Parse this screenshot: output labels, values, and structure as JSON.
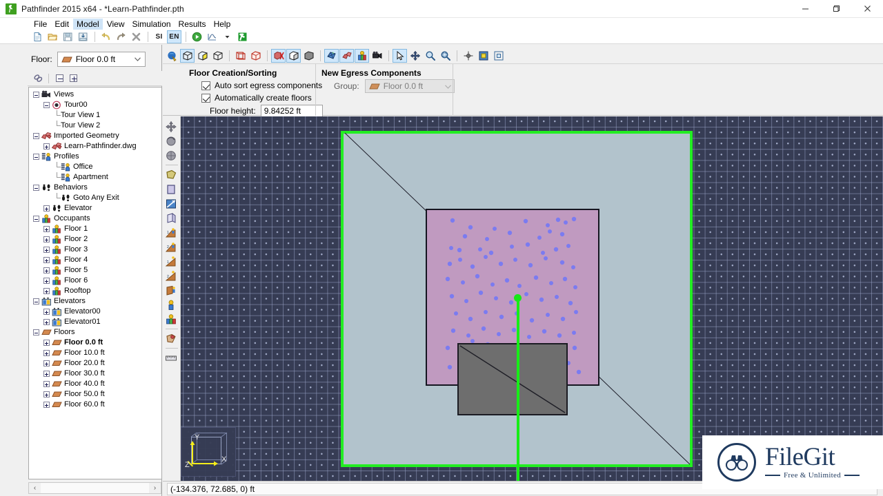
{
  "window": {
    "title": "Pathfinder 2015 x64 - *Learn-Pathfinder.pth",
    "app_icon": "pathfinder-runner-icon",
    "minimize": "—",
    "maximize": "❐",
    "close": "✕"
  },
  "menu": {
    "items": [
      {
        "label": "File",
        "active": false
      },
      {
        "label": "Edit",
        "active": false
      },
      {
        "label": "Model",
        "active": true
      },
      {
        "label": "View",
        "active": false
      },
      {
        "label": "Simulation",
        "active": false
      },
      {
        "label": "Results",
        "active": false
      },
      {
        "label": "Help",
        "active": false
      }
    ]
  },
  "toolbar": {
    "items": [
      {
        "name": "new-file-icon",
        "label": ""
      },
      {
        "name": "open-folder-icon",
        "label": ""
      },
      {
        "name": "save-icon",
        "label": ""
      },
      {
        "name": "save-as-icon",
        "label": ""
      },
      {
        "name": "undo-icon",
        "label": ""
      },
      {
        "name": "redo-icon",
        "label": ""
      },
      {
        "name": "delete-icon",
        "label": ""
      },
      {
        "name": "units-si-button",
        "label": "SI"
      },
      {
        "name": "units-en-button",
        "label": "EN"
      },
      {
        "name": "run-simulation-icon",
        "label": ""
      },
      {
        "name": "results-chart-icon",
        "label": ""
      },
      {
        "name": "results-dropdown-icon",
        "label": ""
      },
      {
        "name": "open-results-viewer-icon",
        "label": ""
      }
    ],
    "active_units": "EN"
  },
  "sidebar": {
    "floor_selector": {
      "label": "Floor:",
      "value": "Floor 0.0 ft",
      "icon": "floor-slab-icon"
    },
    "tree_toolbar": {
      "link_icon": "link-chain-icon",
      "collapse_all": "collapse-all-button",
      "expand_all": "expand-all-button"
    },
    "scrollbar": {
      "left_arrow": "‹",
      "right_arrow": "›"
    },
    "tree": [
      {
        "label": "Views",
        "indent": 0,
        "toggle": "minus",
        "icon": "camera-icon",
        "bold": false
      },
      {
        "label": "Tour00",
        "indent": 1,
        "toggle": "minus",
        "icon": "tour-icon",
        "bold": false
      },
      {
        "label": "Tour View 1",
        "indent": 2,
        "toggle": "none",
        "icon": "none",
        "bold": false
      },
      {
        "label": "Tour View 2",
        "indent": 2,
        "toggle": "none",
        "icon": "none",
        "bold": false
      },
      {
        "label": "Imported Geometry",
        "indent": 0,
        "toggle": "minus",
        "icon": "geometry-icon",
        "bold": false
      },
      {
        "label": "Learn-Pathfinder.dwg",
        "indent": 1,
        "toggle": "plus",
        "icon": "geometry-icon",
        "bold": false
      },
      {
        "label": "Profiles",
        "indent": 0,
        "toggle": "minus",
        "icon": "profile-icon",
        "bold": false
      },
      {
        "label": "Office",
        "indent": 2,
        "toggle": "none",
        "icon": "profile-icon",
        "bold": false
      },
      {
        "label": "Apartment",
        "indent": 2,
        "toggle": "none",
        "icon": "profile-icon",
        "bold": false
      },
      {
        "label": "Behaviors",
        "indent": 0,
        "toggle": "minus",
        "icon": "footprints-icon",
        "bold": false
      },
      {
        "label": "Goto Any Exit",
        "indent": 2,
        "toggle": "none",
        "icon": "footprints-icon",
        "bold": false
      },
      {
        "label": "Elevator",
        "indent": 1,
        "toggle": "plus",
        "icon": "footprints-icon",
        "bold": false
      },
      {
        "label": "Occupants",
        "indent": 0,
        "toggle": "minus",
        "icon": "occupants-icon",
        "bold": false
      },
      {
        "label": "Floor 1",
        "indent": 1,
        "toggle": "plus",
        "icon": "occupants-icon",
        "bold": false
      },
      {
        "label": "Floor 2",
        "indent": 1,
        "toggle": "plus",
        "icon": "occupants-icon",
        "bold": false
      },
      {
        "label": "Floor 3",
        "indent": 1,
        "toggle": "plus",
        "icon": "occupants-icon",
        "bold": false
      },
      {
        "label": "Floor 4",
        "indent": 1,
        "toggle": "plus",
        "icon": "occupants-icon",
        "bold": false
      },
      {
        "label": "Floor 5",
        "indent": 1,
        "toggle": "plus",
        "icon": "occupants-icon",
        "bold": false
      },
      {
        "label": "Floor 6",
        "indent": 1,
        "toggle": "plus",
        "icon": "occupants-icon",
        "bold": false
      },
      {
        "label": "Rooftop",
        "indent": 1,
        "toggle": "plus",
        "icon": "occupants-icon",
        "bold": false
      },
      {
        "label": "Elevators",
        "indent": 0,
        "toggle": "minus",
        "icon": "elevator-icon",
        "bold": false
      },
      {
        "label": "Elevator00",
        "indent": 1,
        "toggle": "plus",
        "icon": "elevator-icon",
        "bold": false
      },
      {
        "label": "Elevator01",
        "indent": 1,
        "toggle": "plus",
        "icon": "elevator-icon",
        "bold": false
      },
      {
        "label": "Floors",
        "indent": 0,
        "toggle": "minus",
        "icon": "floor-slab-icon",
        "bold": false
      },
      {
        "label": "Floor 0.0 ft",
        "indent": 1,
        "toggle": "plus",
        "icon": "floor-slab-icon",
        "bold": true
      },
      {
        "label": "Floor 10.0 ft",
        "indent": 1,
        "toggle": "plus",
        "icon": "floor-slab-icon",
        "bold": false
      },
      {
        "label": "Floor 20.0 ft",
        "indent": 1,
        "toggle": "plus",
        "icon": "floor-slab-icon",
        "bold": false
      },
      {
        "label": "Floor 30.0 ft",
        "indent": 1,
        "toggle": "plus",
        "icon": "floor-slab-icon",
        "bold": false
      },
      {
        "label": "Floor 40.0 ft",
        "indent": 1,
        "toggle": "plus",
        "icon": "floor-slab-icon",
        "bold": false
      },
      {
        "label": "Floor 50.0 ft",
        "indent": 1,
        "toggle": "plus",
        "icon": "floor-slab-icon",
        "bold": false
      },
      {
        "label": "Floor 60.0 ft",
        "indent": 1,
        "toggle": "plus",
        "icon": "floor-slab-icon",
        "bold": false
      }
    ]
  },
  "options": {
    "floor_creation": {
      "title": "Floor Creation/Sorting",
      "auto_sort_label": "Auto sort egress components",
      "auto_sort_checked": true,
      "auto_create_label": "Automatically create floors",
      "auto_create_checked": true,
      "floor_height_label": "Floor height:",
      "floor_height_value": "9.84252 ft"
    },
    "new_egress": {
      "title": "New Egress Components",
      "group_label": "Group:",
      "group_value": "Floor 0.0 ft",
      "group_icon": "floor-slab-icon",
      "disabled": true
    }
  },
  "viewport_toolbar": {
    "items": [
      {
        "name": "navigation-mode-icon",
        "selected": false
      },
      {
        "name": "view-solid-icon",
        "selected": true
      },
      {
        "name": "view-shaded-icon",
        "selected": false
      },
      {
        "name": "view-wireframe-icon",
        "selected": false
      },
      {
        "name": "show-bounding-box-icon",
        "selected": false
      },
      {
        "name": "show-outline-icon",
        "selected": false
      },
      {
        "name": "hide-geometry-icon",
        "selected": true
      },
      {
        "name": "show-geometry-icon",
        "selected": true
      },
      {
        "name": "show-solid-geometry-icon",
        "selected": false
      },
      {
        "name": "show-navigation-mesh-icon",
        "selected": true
      },
      {
        "name": "show-imported-geometry-icon",
        "selected": true
      },
      {
        "name": "show-occupants-icon",
        "selected": true
      },
      {
        "name": "show-cameras-icon",
        "selected": false
      },
      {
        "name": "select-tool-icon",
        "selected": true
      },
      {
        "name": "pan-tool-icon",
        "selected": false
      },
      {
        "name": "zoom-tool-icon",
        "selected": false
      },
      {
        "name": "zoom-window-tool-icon",
        "selected": false
      },
      {
        "name": "reset-view-icon",
        "selected": false
      },
      {
        "name": "zoom-extents-icon",
        "selected": false
      },
      {
        "name": "zoom-selection-icon",
        "selected": false
      }
    ]
  },
  "left_tools": {
    "items": [
      {
        "name": "orbit-tool-icon"
      },
      {
        "name": "rotate-tool-icon"
      },
      {
        "name": "pan-view-tool-icon"
      },
      {
        "name": "draw-room-tool-icon"
      },
      {
        "name": "draw-rectangle-room-icon"
      },
      {
        "name": "draw-door-icon"
      },
      {
        "name": "draw-wall-icon"
      },
      {
        "name": "add-stair-up-icon"
      },
      {
        "name": "add-stair-down-icon"
      },
      {
        "name": "add-ramp-up-icon"
      },
      {
        "name": "add-ramp-down-icon"
      },
      {
        "name": "add-exit-icon"
      },
      {
        "name": "add-occupant-icon"
      },
      {
        "name": "add-occupant-group-icon"
      },
      {
        "name": "add-source-icon"
      },
      {
        "name": "measure-tool-icon"
      }
    ]
  },
  "viewport": {
    "background_color": "#363c54",
    "grid_color": "#96a0c3",
    "floor_plate_color": "#b2c3cc",
    "floor_plate_border": "#22ee22",
    "room_color": "#c09ac0",
    "occupant_dot_color": "#7b7bf0",
    "block_color": "#6e6e6e",
    "guideline_color": "#17ee17",
    "axis": {
      "x_label": "X",
      "y_label": "Y",
      "z_label": "Z",
      "color": "#f5ee1a"
    }
  },
  "status": {
    "coordinates": "(-134.376, 72.685, 0) ft"
  },
  "watermark": {
    "name": "FileGit",
    "tagline": "Free & Unlimited",
    "icon": "binoculars-icon",
    "color": "#1f3a5f"
  }
}
